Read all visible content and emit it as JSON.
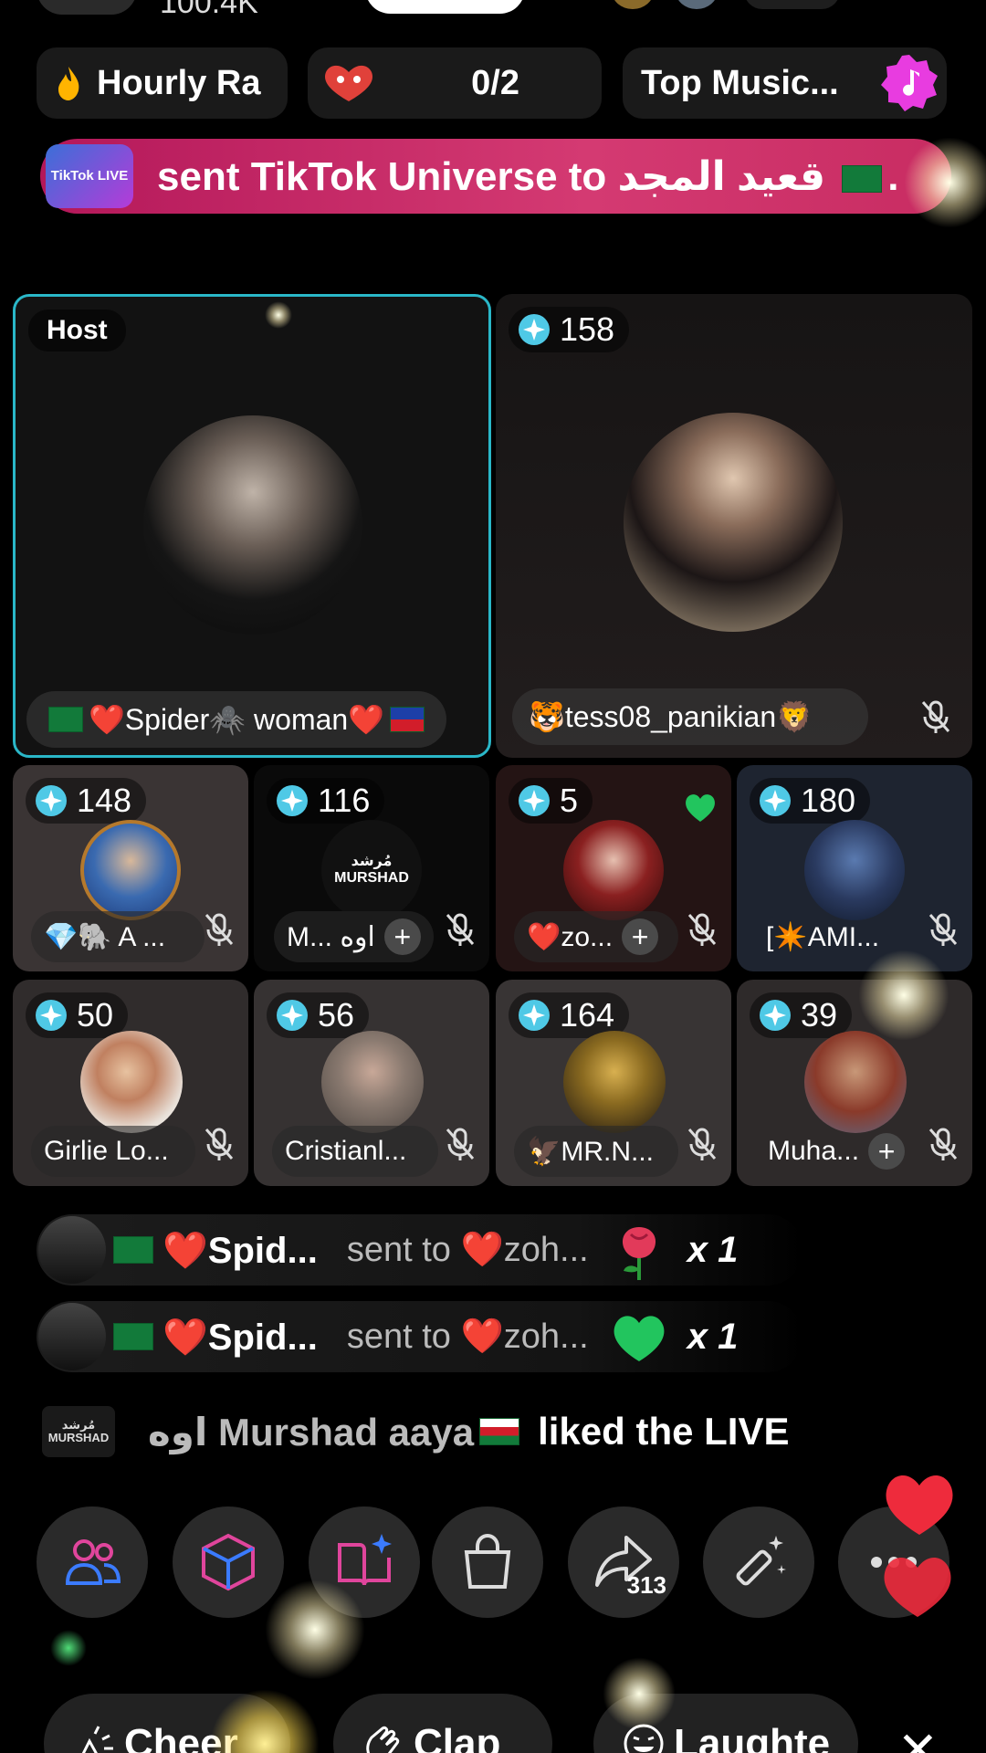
{
  "top": {
    "viewers": "100.4K"
  },
  "chips": {
    "hourly_label": "Hourly Ra",
    "counter": "0/2",
    "music_label": "Top Music..."
  },
  "banner": {
    "logo_text": "TikTok LIVE",
    "text_prefix": "sent TikTok Universe to",
    "recipient": "قعيد المجد",
    "text_suffix": "."
  },
  "guests": {
    "host": {
      "tag": "Host",
      "name": "❤️Spider🕷️ woman❤️"
    },
    "big2": {
      "score": "158",
      "name": "🐯tess08_panikian🦁"
    },
    "row1": [
      {
        "score": "148",
        "name": "💎🐘 A ..."
      },
      {
        "score": "116",
        "name": "M... اوه",
        "logo": "مُرشد MURSHAD"
      },
      {
        "score": "5",
        "name": "❤️zo..."
      },
      {
        "score": "180",
        "name": "[✴️AMI..."
      }
    ],
    "row2": [
      {
        "score": "50",
        "name": "Girlie Lo..."
      },
      {
        "score": "56",
        "name": "Cristianl..."
      },
      {
        "score": "164",
        "name": "🦅MR.N..."
      },
      {
        "score": "39",
        "name": "Muha..."
      }
    ]
  },
  "feed": [
    {
      "sender": "❤️Spid...",
      "middle": "sent to ❤️zoh...",
      "count": "x 1",
      "gift": "rose"
    },
    {
      "sender": "❤️Spid...",
      "middle": "sent to ❤️zoh...",
      "count": "x 1",
      "gift": "green-heart"
    }
  ],
  "like": {
    "logo": "مُرشد MURSHAD",
    "user": "اوه Murshad aaya",
    "text": "liked the LIVE"
  },
  "actions": {
    "share_count": "313"
  },
  "reactions": {
    "cheer": "Cheer",
    "clap": "Clap",
    "laughter": "Laughte"
  },
  "colors": {
    "host_border": "#2ab7c8",
    "banner": "#c82c62",
    "music_badge": "#e83ce0"
  }
}
